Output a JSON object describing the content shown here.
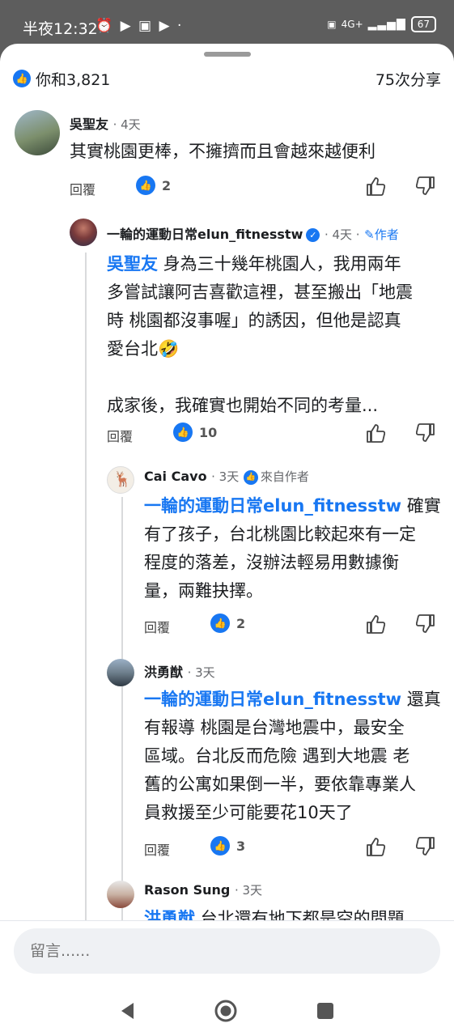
{
  "status_bar": {
    "time": "半夜12:32",
    "notif_icons": "⏰ ▶ ▣ ▶ ·",
    "net": "4G+",
    "battery": "67"
  },
  "reactions": {
    "summary": "你和3,821",
    "shares": "75次分享"
  },
  "comments": [
    {
      "author": "吳聖友",
      "time": "· 4天",
      "text": "其實桃園更棒，不擁擠而且會越來越便利",
      "reply_label": "回覆",
      "likes": "2"
    },
    {
      "author": "一輪的運動日常elun_fitnesstw",
      "time": "· 4天 ·",
      "author_badge": "作者",
      "mention": "吳聖友",
      "text_lines": [
        " 身為三十幾年桃園人，我用兩年",
        "多嘗試讓阿吉喜歡這裡，甚至搬出「地震",
        "時 桃園都沒事喔」的誘因，但他是認真",
        "愛台北🤣",
        "",
        "成家後，我確實也開始不同的考量..."
      ],
      "reply_label": "回覆",
      "likes": "10"
    },
    {
      "author": "Cai Cavo",
      "time": "· 3天",
      "from_author": "來自作者",
      "mention": "一輪的運動日常elun_fitnesstw",
      "text_lines": [
        " 確實",
        "有了孩子，台北桃園比較起來有一定",
        "程度的落差，沒辦法輕易用數據衡",
        "量，兩難抉擇。"
      ],
      "reply_label": "回覆",
      "likes": "2"
    },
    {
      "author": "洪勇猷",
      "time": "· 3天",
      "mention": "一輪的運動日常elun_fitnesstw",
      "text_lines": [
        " 還真",
        "有報導 桃園是台灣地震中，最安全",
        "區域。台北反而危險 遇到大地震 老",
        "舊的公寓如果倒一半，要依靠專業人",
        "員救援至少可能要花10天了"
      ],
      "reply_label": "回覆",
      "likes": "3"
    },
    {
      "author": "Rason Sung",
      "time": "· 3天",
      "mention": "洪勇猷",
      "text_partial": " 台北還有地下都是空的問題"
    }
  ],
  "composer": {
    "placeholder": "留言......"
  }
}
